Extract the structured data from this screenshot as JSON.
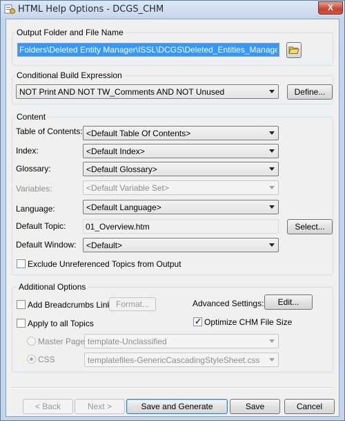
{
  "window": {
    "title": "HTML Help Options - DCGS_CHM",
    "close_label": "X"
  },
  "output": {
    "group_label": "Output Folder and File Name",
    "path_value": "Folders\\Deleted Entity Manager\\ISSL\\DCGS\\Deleted_Entities_Manager.chm"
  },
  "conditional": {
    "group_label": "Conditional Build Expression",
    "expression": "NOT Print AND NOT TW_Comments AND NOT Unused",
    "define_label": "Define..."
  },
  "content": {
    "group_label": "Content",
    "toc_label": "Table of Contents:",
    "toc_value": "<Default Table Of Contents>",
    "index_label": "Index:",
    "index_value": "<Default Index>",
    "glossary_label": "Glossary:",
    "glossary_value": "<Default Glossary>",
    "variables_label": "Variables:",
    "variables_value": "<Default Variable Set>",
    "language_label": "Language:",
    "language_value": "<Default Language>",
    "topic_label": "Default Topic:",
    "topic_value": "01_Overview.htm",
    "select_label": "Select...",
    "window_label": "Default Window:",
    "window_value": "<Default>",
    "exclude_label": "Exclude Unreferenced Topics from Output"
  },
  "additional": {
    "group_label": "Additional Options",
    "breadcrumbs_label": "Add Breadcrumbs Links",
    "format_label": "Format...",
    "advanced_label": "Advanced Settings:",
    "edit_label": "Edit...",
    "apply_all_label": "Apply to all Topics",
    "optimize_label": "Optimize CHM File Size",
    "master_page_label": "Master Page",
    "master_page_value": "template-Unclassified",
    "css_label": "CSS",
    "css_value": "templatefiles-GenericCascadingStyleSheet.css"
  },
  "footer": {
    "back_label": "< Back",
    "next_label": "Next >",
    "save_generate_label": "Save and Generate",
    "save_label": "Save",
    "cancel_label": "Cancel"
  }
}
